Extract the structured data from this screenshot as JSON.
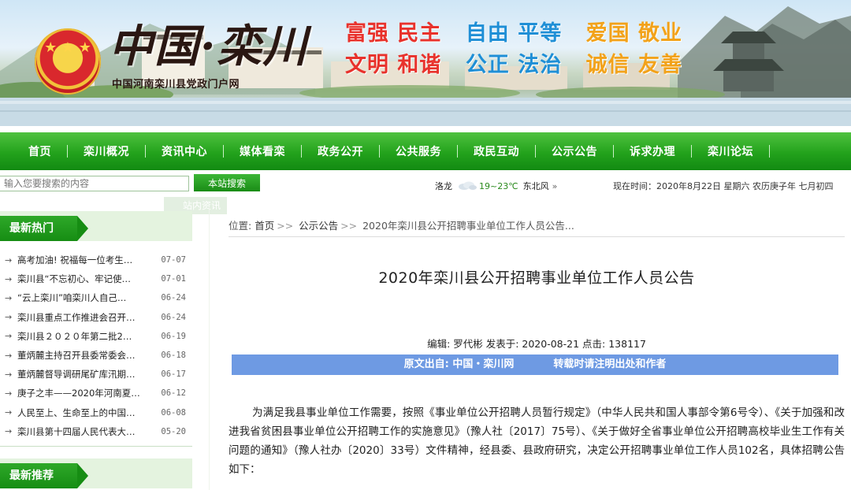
{
  "header": {
    "logo_title": "中国·栾川",
    "logo_subtitle": "中国河南栾川县党政门户网",
    "slogan_row1": [
      "富强 民主",
      "自由 平等",
      "爱国 敬业"
    ],
    "slogan_row2": [
      "文明 和谐",
      "公正 法治",
      "诚信 友善"
    ]
  },
  "nav": {
    "items": [
      "首页",
      "栾川概况",
      "资讯中心",
      "媒体看栾",
      "政务公开",
      "公共服务",
      "政民互动",
      "公示公告",
      "诉求办理",
      "栾川论坛"
    ]
  },
  "search": {
    "placeholder": "输入您要搜索的内容",
    "button_label": "本站搜索",
    "dropdown_hint": "站内资讯"
  },
  "weather": {
    "city": "洛龙",
    "temp": "19~23℃",
    "wind": "东北风",
    "more": "»"
  },
  "datetime": "现在时间：2020年8月22日 星期六 农历庚子年 七月初四",
  "sidebar": {
    "hot_title": "最新热门",
    "hot_items": [
      {
        "title": "高考加油! 祝福每一位考生…",
        "date": "07-07"
      },
      {
        "title": "栾川县“不忘初心、牢记使…",
        "date": "07-01"
      },
      {
        "title": "“云上栾川”咱栾川人自己…",
        "date": "06-24"
      },
      {
        "title": "栾川县重点工作推进会召开…",
        "date": "06-24"
      },
      {
        "title": "栾川县２０２０年第二批2…",
        "date": "06-19"
      },
      {
        "title": "董炳麓主持召开县委常委会…",
        "date": "06-18"
      },
      {
        "title": "董炳麓督导调研尾矿库汛期…",
        "date": "06-17"
      },
      {
        "title": "庚子之丰——2020年河南夏…",
        "date": "06-12"
      },
      {
        "title": "人民至上、生命至上的中国…",
        "date": "06-08"
      },
      {
        "title": "栾川县第十四届人民代表大…",
        "date": "05-20"
      }
    ],
    "rec_title": "最新推荐"
  },
  "breadcrumb": {
    "prefix": "位置:",
    "home": "首页",
    "section": "公示公告",
    "current": "2020年栾川县公开招聘事业单位工作人员公告...",
    "sep": ">>"
  },
  "article": {
    "title": "2020年栾川县公开招聘事业单位工作人员公告",
    "meta": "编辑: 罗代彬 发表于: 2020-08-21 点击: 138117",
    "source_label": "原文出自:   中国・栾川网",
    "source_note": "转载时请注明出处和作者",
    "body": "为满足我县事业单位工作需要，按照《事业单位公开招聘人员暂行规定》（中华人民共和国人事部令第6号令）、《关于加强和改进我省贫困县事业单位公开招聘工作的实施意见》（豫人社〔2017〕75号）、《关于做好全省事业单位公开招聘高校毕业生工作有关问题的通知》（豫人社办〔2020〕33号）文件精神，经县委、县政府研究，决定公开招聘事业单位工作人员102名，具体招聘公告如下："
  },
  "colors": {
    "nav_green": "#1f9a19",
    "source_blue": "#6e9ae3",
    "slogan_red": "#e8322c",
    "slogan_blue": "#1f8fd6",
    "slogan_yellow": "#f2a21a"
  }
}
